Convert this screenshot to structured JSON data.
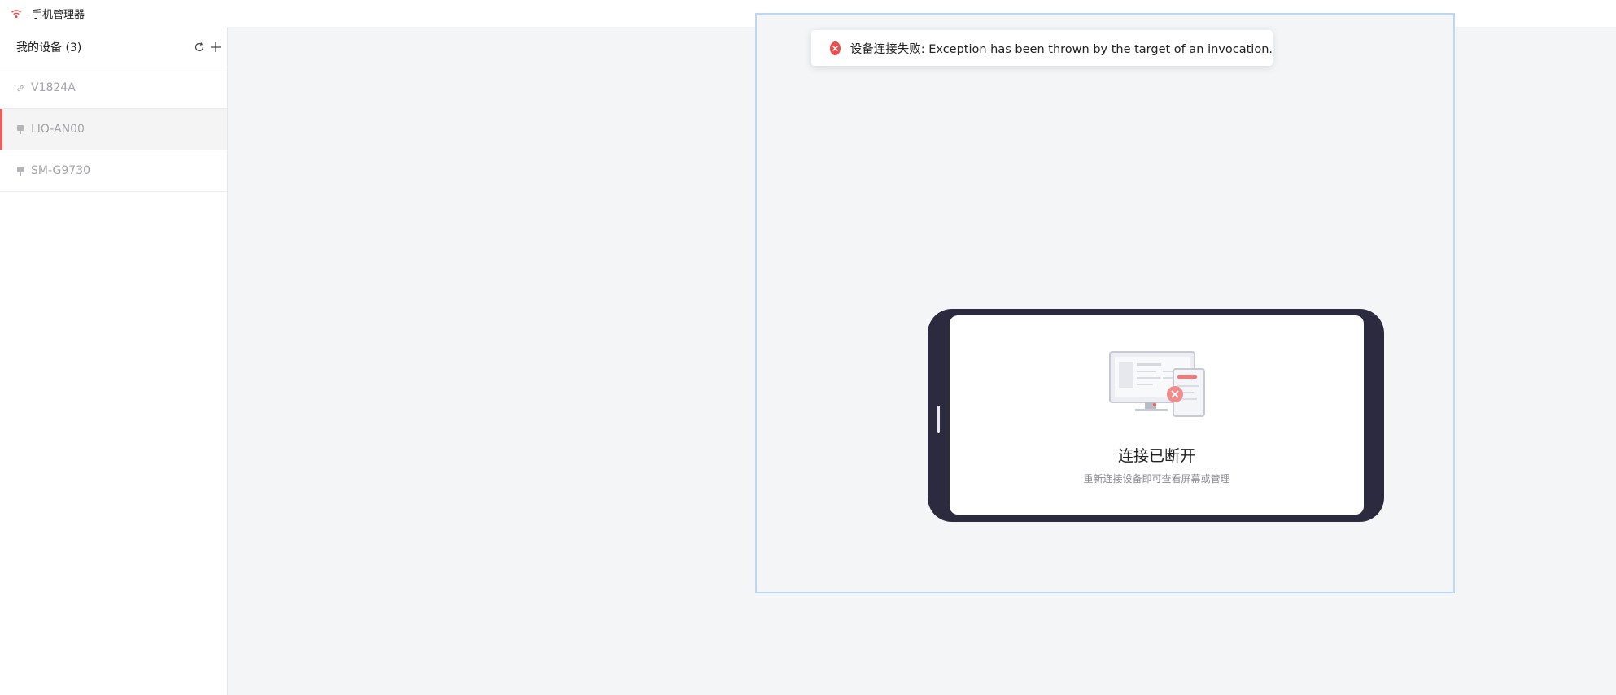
{
  "window": {
    "title": "手机管理器",
    "icon": "wifi-icon",
    "accent": "#f05a5a"
  },
  "sidebar": {
    "title": "我的设备 (3)",
    "refresh_icon": "refresh-icon",
    "add_icon": "plus-icon",
    "devices": [
      {
        "name": "V1824A",
        "icon": "link-icon",
        "active": false
      },
      {
        "name": "LIO-AN00",
        "icon": "usb-icon",
        "active": true
      },
      {
        "name": "SM-G9730",
        "icon": "usb-icon",
        "active": false
      }
    ]
  },
  "toast": {
    "icon": "error-circle-icon",
    "message": "设备连接失败: Exception has been thrown by the target of an invocation.",
    "color": "#ef4d4d"
  },
  "phone_panel": {
    "status_title": "连接已断开",
    "status_subtitle": "重新连接设备即可查看屏幕或管理",
    "illustration": "disconnected-devices-illustration"
  }
}
